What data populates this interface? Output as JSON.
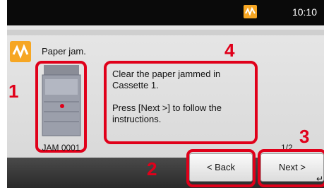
{
  "status_bar": {
    "time": "10:10"
  },
  "alert": {
    "title": "Paper jam."
  },
  "device": {
    "jam_code": "JAM 0001"
  },
  "message": {
    "line1": "Clear the paper jammed in Cassette 1.",
    "line2": "Press [Next >] to follow the instructions."
  },
  "pagination": {
    "counter": "1/2"
  },
  "buttons": {
    "back": "< Back",
    "next": "Next >",
    "enter_icon": "↵"
  },
  "callouts": {
    "one": "1",
    "two": "2",
    "three": "3",
    "four": "4"
  },
  "colors": {
    "alert_orange": "#f6a623",
    "callout_red": "#e0001a"
  }
}
